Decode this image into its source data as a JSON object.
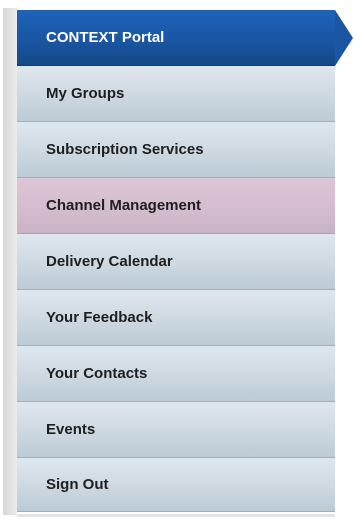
{
  "menu": {
    "items": [
      {
        "label": "CONTEXT Portal",
        "state": "active"
      },
      {
        "label": "My Groups",
        "state": "normal"
      },
      {
        "label": "Subscription Services",
        "state": "normal"
      },
      {
        "label": "Channel Management",
        "state": "highlight"
      },
      {
        "label": "Delivery Calendar",
        "state": "normal"
      },
      {
        "label": "Your Feedback",
        "state": "normal"
      },
      {
        "label": "Your Contacts",
        "state": "normal"
      },
      {
        "label": "Events",
        "state": "normal"
      },
      {
        "label": "Sign Out",
        "state": "normal"
      }
    ]
  },
  "colors": {
    "active_bg": "#1a56a4",
    "active_text": "#ffffff",
    "item_bg": "#cdd8e1",
    "item_text": "#1f1f1f",
    "highlight_bg": "#d2bccd"
  }
}
